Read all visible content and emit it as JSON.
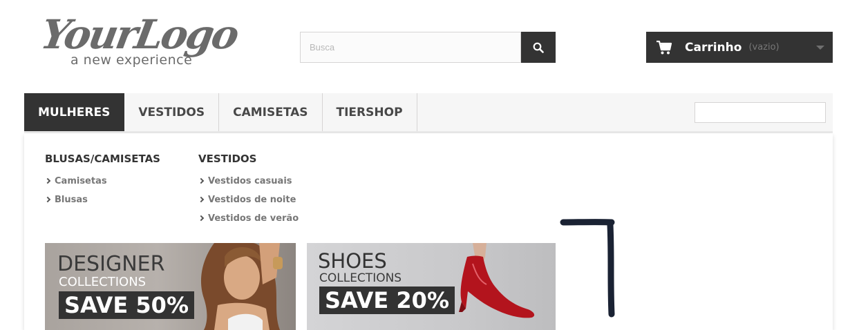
{
  "logo": {
    "main": "YourLogo",
    "tagline": "a new experience"
  },
  "search": {
    "placeholder": "Busca",
    "value": ""
  },
  "cart": {
    "label": "Carrinho",
    "status": "(vazio)"
  },
  "menu": {
    "tabs": [
      {
        "label": "MULHERES",
        "active": true
      },
      {
        "label": "VESTIDOS",
        "active": false
      },
      {
        "label": "CAMISETAS",
        "active": false
      },
      {
        "label": "TIERSHOP",
        "active": false
      }
    ]
  },
  "dropdown": {
    "columns": [
      {
        "title": "BLUSAS/CAMISETAS",
        "links": [
          "Camisetas",
          "Blusas"
        ]
      },
      {
        "title": "VESTIDOS",
        "links": [
          "Vestidos casuais",
          "Vestidos de noite",
          "Vestidos de verão"
        ]
      }
    ],
    "banners": [
      {
        "title": "DESIGNER",
        "subtitle": "COLLECTIONS",
        "sale": "SAVE 50%"
      },
      {
        "title": "SHOES",
        "subtitle": "COLLECTIONS",
        "sale": "SAVE 20%"
      }
    ]
  },
  "colors": {
    "dark": "#333333",
    "menu_bg": "#f6f6f6",
    "link_gray": "#777777",
    "annotation": "#1a2233"
  },
  "icons": {
    "search": "search-icon",
    "cart": "cart-icon",
    "caret": "chevron-down-icon",
    "bullet": "chevron-right-icon"
  }
}
